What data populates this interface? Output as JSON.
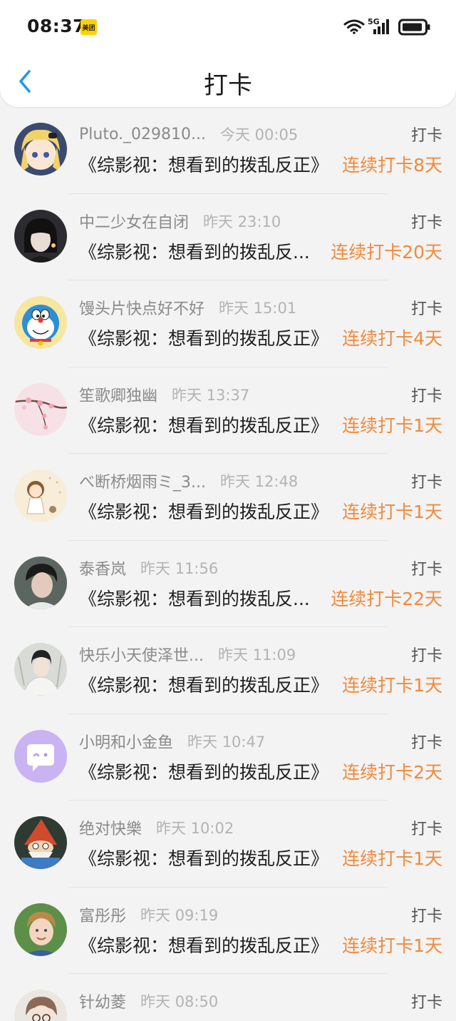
{
  "status_bar": {
    "time": "08:37",
    "app_badge": "美团",
    "network": "5G",
    "icons": [
      "wifi-icon",
      "signal-icon",
      "battery-icon"
    ]
  },
  "nav": {
    "title": "打卡",
    "back_icon": "chevron-left-icon",
    "accent_color": "#2196f3"
  },
  "colors": {
    "streak": "#f08a3c",
    "username": "#8a8a8a",
    "timestamp": "#b3b3b3"
  },
  "items": [
    {
      "username": "Pluto._029810...",
      "time": "今天 00:05",
      "label": "打卡",
      "topic": "《综影视：想看到的拨乱反正》",
      "streak": "连续打卡8天",
      "avatar": "anime-blonde-girl-avatar"
    },
    {
      "username": "中二少女在自闭",
      "time": "昨天 23:10",
      "label": "打卡",
      "topic": "《综影视：想看到的拨乱反...",
      "streak": "连续打卡20天",
      "avatar": "dark-portrait-avatar"
    },
    {
      "username": "馒头片快点好不好",
      "time": "昨天 15:01",
      "label": "打卡",
      "topic": "《综影视：想看到的拨乱反正》",
      "streak": "连续打卡4天",
      "avatar": "doraemon-avatar"
    },
    {
      "username": "笙歌卿独幽",
      "time": "昨天 13:37",
      "label": "打卡",
      "topic": "《综影视：想看到的拨乱反正》",
      "streak": "连续打卡1天",
      "avatar": "cherry-blossom-avatar"
    },
    {
      "username": "べ断桥烟雨ミ_3...",
      "time": "昨天 12:48",
      "label": "打卡",
      "topic": "《综影视：想看到的拨乱反正》",
      "streak": "连续打卡1天",
      "avatar": "cartoon-girl-avatar"
    },
    {
      "username": "泰香岚",
      "time": "昨天 11:56",
      "label": "打卡",
      "topic": "《综影视：想看到的拨乱反...",
      "streak": "连续打卡22天",
      "avatar": "male-portrait-avatar"
    },
    {
      "username": "快乐小天使泽世...",
      "time": "昨天 11:09",
      "label": "打卡",
      "topic": "《综影视：想看到的拨乱反正》",
      "streak": "连续打卡1天",
      "avatar": "costume-portrait-avatar"
    },
    {
      "username": "小明和小金鱼",
      "time": "昨天 10:47",
      "label": "打卡",
      "topic": "《综影视：想看到的拨乱反正》",
      "streak": "连续打卡2天",
      "avatar": "chat-bubble-avatar"
    },
    {
      "username": "绝对快樂",
      "time": "昨天 10:02",
      "label": "打卡",
      "topic": "《综影视：想看到的拨乱反正》",
      "streak": "连续打卡1天",
      "avatar": "gnome-cartoon-avatar"
    },
    {
      "username": "富彤彤",
      "time": "昨天 09:19",
      "label": "打卡",
      "topic": "《综影视：想看到的拨乱反正》",
      "streak": "连续打卡1天",
      "avatar": "child-photo-avatar"
    },
    {
      "username": "针幼菱",
      "time": "昨天 08:50",
      "label": "打卡",
      "topic": "",
      "streak": "",
      "avatar": "anime-glasses-avatar"
    }
  ]
}
